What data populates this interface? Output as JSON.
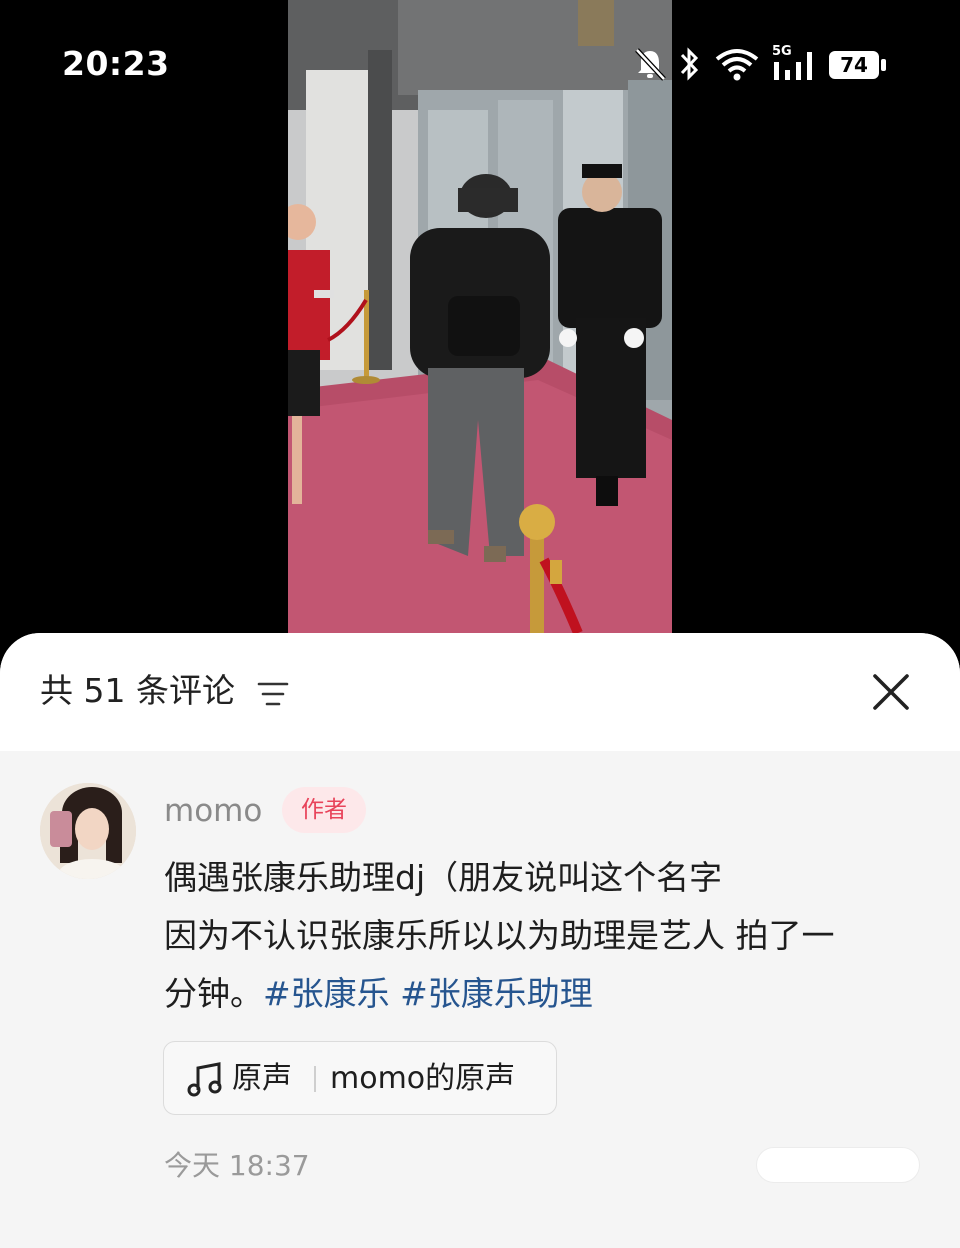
{
  "status_bar": {
    "time": "20:23",
    "battery": "74",
    "network": "5G",
    "icons": [
      "bell-muted-icon",
      "bluetooth-icon",
      "wifi-icon",
      "signal-5g-icon",
      "battery-icon"
    ]
  },
  "video": {
    "scene": "mall-entrance-red-carpet"
  },
  "comments_sheet": {
    "count_label": "共 51 条评论",
    "sort_icon": "sort-lines-icon",
    "close_icon": "close-icon"
  },
  "comment": {
    "username": "momo",
    "author_badge": "作者",
    "text_line1": "偶遇张康乐助理dj（朋友说叫这个名字",
    "text_line2": "因为不认识张康乐所以以为助理是艺人 拍了一",
    "text_line3": "分钟。",
    "hashtags": [
      "#张康乐",
      "#张康乐助理"
    ],
    "music_label": "原声",
    "music_title": "momo的原声",
    "timestamp": "今天 18:37"
  },
  "colors": {
    "accent_badge_text": "#e8435a",
    "badge_bg": "#fde8ea",
    "hashtag": "#26558f",
    "sheet_bg": "#f5f5f5"
  }
}
